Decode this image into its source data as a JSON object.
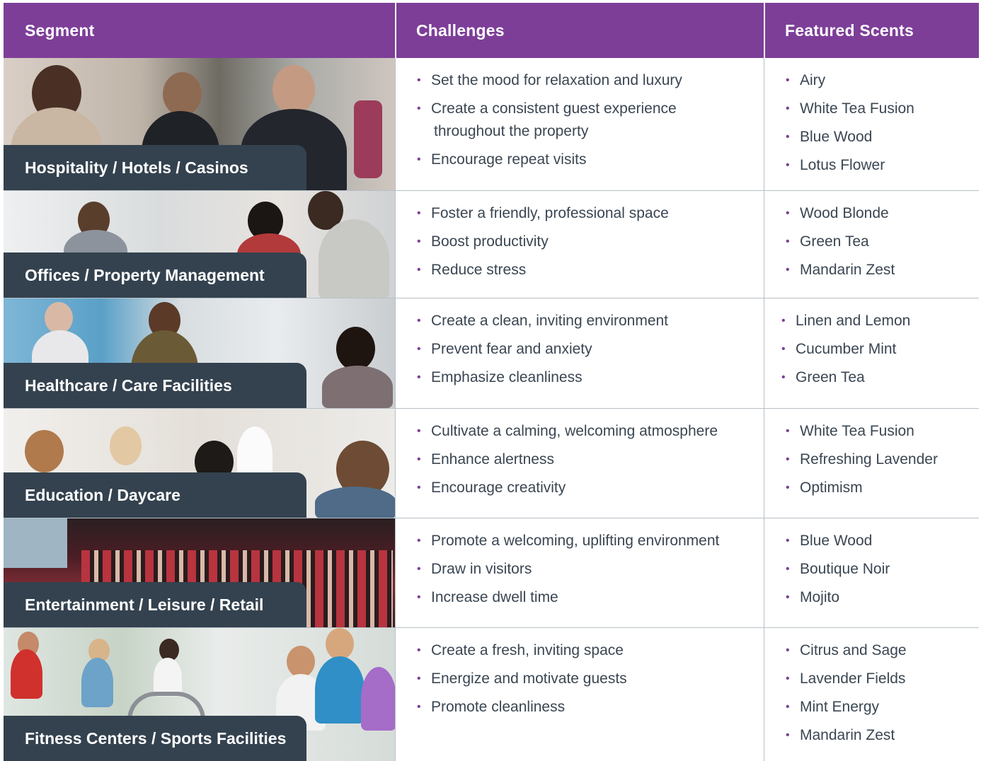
{
  "header": {
    "segment": "Segment",
    "challenges": "Challenges",
    "scents": "Featured Scents"
  },
  "colors": {
    "header_bg": "#7d3e98",
    "label_bg": "#34424f",
    "bullet": "#7d3e98",
    "text": "#3a4652"
  },
  "rows": [
    {
      "segment": "Hospitality / Hotels / Casinos",
      "challenges": [
        "Set the mood for relaxation and luxury",
        "Create a consistent guest experience\nthroughout the property",
        "Encourage repeat visits"
      ],
      "scents": [
        "Airy",
        "White Tea Fusion",
        "Blue Wood",
        "Lotus Flower"
      ]
    },
    {
      "segment": "Offices / Property Management",
      "challenges": [
        "Foster a friendly, professional space",
        "Boost productivity",
        "Reduce stress"
      ],
      "scents": [
        "Wood Blonde",
        "Green Tea",
        "Mandarin Zest"
      ]
    },
    {
      "segment": "Healthcare / Care Facilities",
      "challenges": [
        "Create a clean, inviting environment",
        "Prevent fear and anxiety",
        "Emphasize cleanliness"
      ],
      "scents": [
        "Linen and Lemon",
        "Cucumber Mint",
        "Green Tea"
      ]
    },
    {
      "segment": "Education / Daycare",
      "challenges": [
        "Cultivate a calming, welcoming atmosphere",
        "Enhance alertness",
        "Encourage creativity"
      ],
      "scents": [
        "White Tea Fusion",
        "Refreshing Lavender",
        "Optimism"
      ]
    },
    {
      "segment": "Entertainment / Leisure / Retail",
      "challenges": [
        "Promote a welcoming, uplifting environment",
        "Draw in visitors",
        "Increase dwell time"
      ],
      "scents": [
        "Blue Wood",
        "Boutique Noir",
        "Mojito"
      ]
    },
    {
      "segment": "Fitness Centers / Sports Facilities",
      "challenges": [
        "Create a fresh, inviting space",
        "Energize and motivate guests",
        "Promote cleanliness"
      ],
      "scents": [
        "Citrus and Sage",
        "Lavender Fields",
        "Mint Energy",
        "Mandarin Zest"
      ]
    }
  ]
}
